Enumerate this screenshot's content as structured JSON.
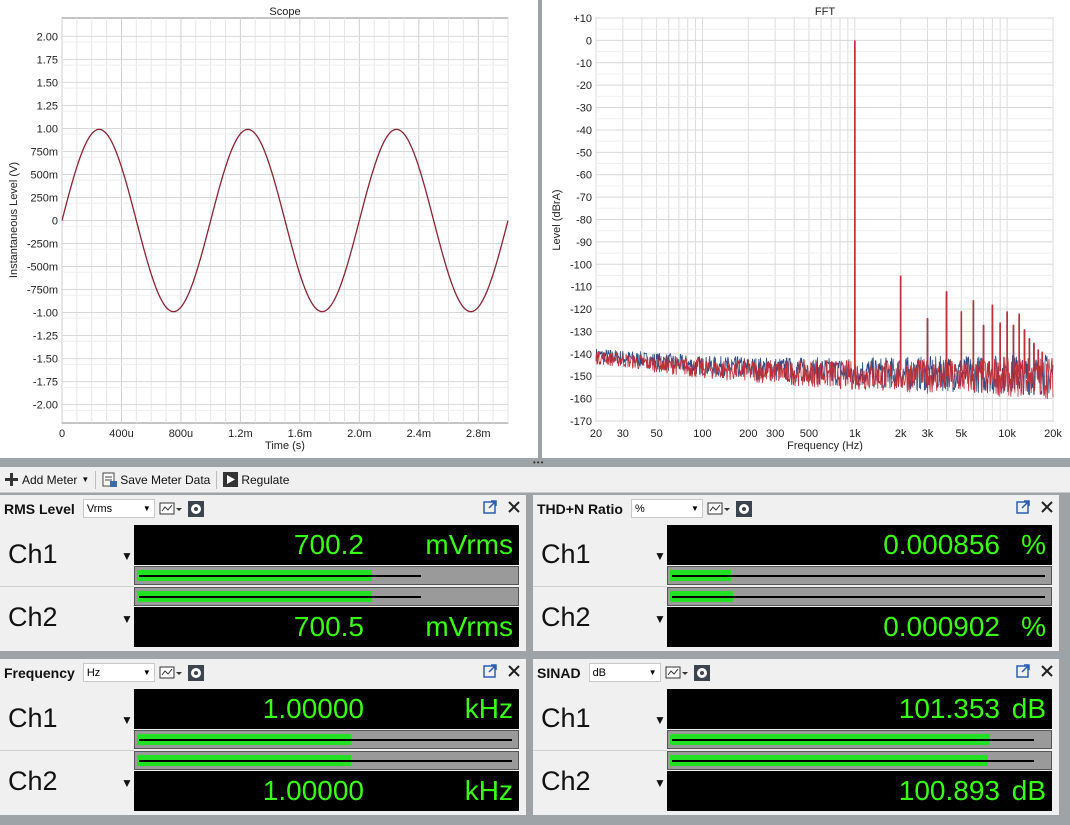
{
  "scope": {
    "title": "Scope",
    "xlabel": "Time (s)",
    "ylabel": "Instantaneous Level (V)",
    "x_ticks": [
      "0",
      "400u",
      "800u",
      "1.2m",
      "1.6m",
      "2.0m",
      "2.4m",
      "2.8m"
    ],
    "y_ticks": [
      "2.00",
      "1.75",
      "1.50",
      "1.25",
      "1.00",
      "750m",
      "500m",
      "250m",
      "0",
      "-250m",
      "-500m",
      "-750m",
      "-1.00",
      "-1.25",
      "-1.50",
      "-1.75",
      "-2.00"
    ],
    "trace_color": "#8b2433"
  },
  "chart_data": [
    {
      "type": "line",
      "title": "Scope",
      "xlabel": "Time (s)",
      "ylabel": "Instantaneous Level (V)",
      "xlim": [
        0,
        0.003
      ],
      "ylim": [
        -2.2,
        2.2
      ],
      "grid": true,
      "series": [
        {
          "values_description": "sine",
          "amplitude": 0.99,
          "frequency_hz": 1000,
          "start_phase_deg": 0
        }
      ]
    },
    {
      "type": "line",
      "title": "FFT",
      "xlabel": "Frequency (Hz)",
      "ylabel": "Level (dBrA)",
      "xscale": "log",
      "xlim": [
        20,
        20000
      ],
      "ylim": [
        -170,
        10
      ],
      "grid": true,
      "noise_floor_db": [
        {
          "x": 20,
          "y": -141
        },
        {
          "x": 100,
          "y": -146
        },
        {
          "x": 1000,
          "y": -149
        },
        {
          "x": 20000,
          "y": -150
        }
      ],
      "peaks": [
        {
          "x": 1000,
          "y": 0
        },
        {
          "x": 2000,
          "y": -105
        },
        {
          "x": 3000,
          "y": -124
        },
        {
          "x": 4000,
          "y": -112
        },
        {
          "x": 5000,
          "y": -121
        },
        {
          "x": 6000,
          "y": -116
        },
        {
          "x": 7000,
          "y": -127
        },
        {
          "x": 8000,
          "y": -118
        },
        {
          "x": 9000,
          "y": -126
        },
        {
          "x": 10000,
          "y": -121
        },
        {
          "x": 11000,
          "y": -127
        },
        {
          "x": 12000,
          "y": -122
        },
        {
          "x": 13000,
          "y": -129
        },
        {
          "x": 14000,
          "y": -133
        },
        {
          "x": 15000,
          "y": -135
        },
        {
          "x": 16000,
          "y": -138
        },
        {
          "x": 17000,
          "y": -139
        }
      ]
    }
  ],
  "fft": {
    "title": "FFT",
    "xlabel": "Frequency (Hz)",
    "ylabel": "Level (dBrA)",
    "x_ticks": [
      {
        "f": 20,
        "label": "20"
      },
      {
        "f": 30,
        "label": "30"
      },
      {
        "f": 50,
        "label": "50"
      },
      {
        "f": 100,
        "label": "100"
      },
      {
        "f": 200,
        "label": "200"
      },
      {
        "f": 300,
        "label": "300"
      },
      {
        "f": 500,
        "label": "500"
      },
      {
        "f": 1000,
        "label": "1k"
      },
      {
        "f": 2000,
        "label": "2k"
      },
      {
        "f": 3000,
        "label": "3k"
      },
      {
        "f": 5000,
        "label": "5k"
      },
      {
        "f": 10000,
        "label": "10k"
      },
      {
        "f": 20000,
        "label": "20k"
      }
    ],
    "y_ticks": [
      "+10",
      "0",
      "-10",
      "-20",
      "-30",
      "-40",
      "-50",
      "-60",
      "-70",
      "-80",
      "-90",
      "-100",
      "-110",
      "-120",
      "-130",
      "-140",
      "-150",
      "-160",
      "-170"
    ],
    "ch1_color": "#2b4a80",
    "ch2_color": "#c0303a"
  },
  "toolbar": {
    "add_meter": "Add Meter",
    "save_meter_data": "Save Meter Data",
    "regulate": "Regulate"
  },
  "meters": {
    "rms": {
      "title": "RMS Level",
      "unit_select": "Vrms",
      "ch1": {
        "label": "Ch1",
        "value": "700.2",
        "unit": "mVrms",
        "fill": 0.62,
        "peak": 0.76
      },
      "ch2": {
        "label": "Ch2",
        "value": "700.5",
        "unit": "mVrms",
        "fill": 0.62,
        "peak": 0.76
      }
    },
    "thdn": {
      "title": "THD+N Ratio",
      "unit_select": "%",
      "ch1": {
        "label": "Ch1",
        "value": "0.000856",
        "unit": "%",
        "fill": 0.16,
        "peak": 1.0
      },
      "ch2": {
        "label": "Ch2",
        "value": "0.000902",
        "unit": "%",
        "fill": 0.165,
        "peak": 1.0
      }
    },
    "freq": {
      "title": "Frequency",
      "unit_select": "Hz",
      "ch1": {
        "label": "Ch1",
        "value": "1.00000",
        "unit": "kHz",
        "fill": 0.565,
        "peak": 1.0
      },
      "ch2": {
        "label": "Ch2",
        "value": "1.00000",
        "unit": "kHz",
        "fill": 0.565,
        "peak": 1.0
      }
    },
    "sinad": {
      "title": "SINAD",
      "unit_select": "dB",
      "ch1": {
        "label": "Ch1",
        "value": "101.353",
        "unit": "dB",
        "fill": 0.845,
        "peak": 0.97
      },
      "ch2": {
        "label": "Ch2",
        "value": "100.893",
        "unit": "dB",
        "fill": 0.84,
        "peak": 0.97
      }
    }
  }
}
